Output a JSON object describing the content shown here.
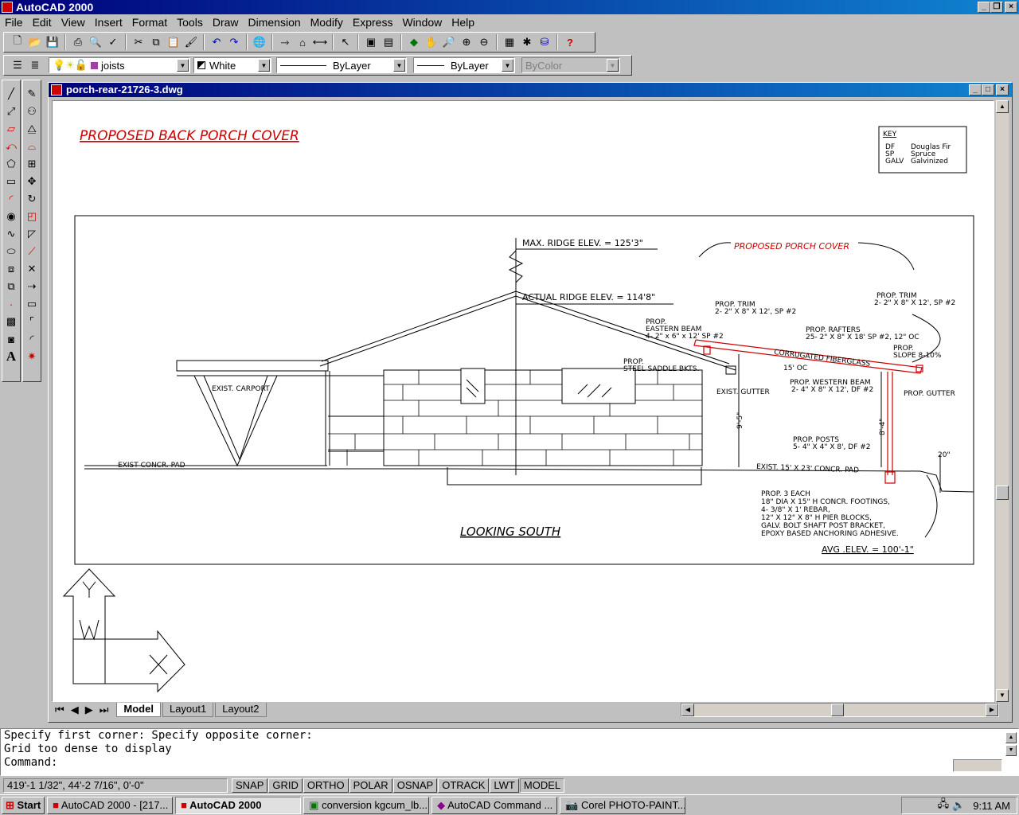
{
  "app": {
    "title": "AutoCAD 2000"
  },
  "menu": [
    "File",
    "Edit",
    "View",
    "Insert",
    "Format",
    "Tools",
    "Draw",
    "Dimension",
    "Modify",
    "Express",
    "Window",
    "Help"
  ],
  "layers": {
    "layer_name": "joists",
    "color": "White",
    "linetype": "ByLayer",
    "lineweight": "ByLayer",
    "plotstyle": "ByColor"
  },
  "document": {
    "title": "porch-rear-21726-3.dwg"
  },
  "drawing": {
    "title": "PROPOSED BACK PORCH COVER",
    "key": {
      "heading": "KEY",
      "entries": [
        {
          "abbr": "DF",
          "meaning": "Douglas Fir"
        },
        {
          "abbr": "SP",
          "meaning": "Spruce"
        },
        {
          "abbr": "GALV",
          "meaning": "Galvinized"
        }
      ]
    },
    "max_ridge": "MAX. RIDGE ELEV. = 125'3\"",
    "actual_ridge": "ACTUAL RIDGE ELEV. = 114'8\"",
    "proposed_porch": "PROPOSED PORCH COVER",
    "prop_trim_1_a": "PROP. TRIM",
    "prop_trim_1_b": "2- 2\" X 8\" X 12', SP #2",
    "prop_trim_2_a": "PROP. TRIM",
    "prop_trim_2_b": "2- 2\" X 8\" X 12', SP #2",
    "eastern_beam_a": "PROP.",
    "eastern_beam_b": "EASTERN BEAM",
    "eastern_beam_c": "4- 2\" x 6\" x 12' SP #2",
    "rafters_a": "PROP. RAFTERS",
    "rafters_b": "25- 2\" X 8\" X 18' SP #2, 12\" OC",
    "corrugated": "CORRUGATED FIBERGLASS",
    "slope_a": "PROP.",
    "slope_b": "SLOPE 8-10%",
    "saddle_a": "PROP.",
    "saddle_b": "STEEL SADDLE BKTS.",
    "oc_15": "15' OC",
    "western_beam_a": "PROP. WESTERN BEAM",
    "western_beam_b": "2- 4\" X 8\" X 12', DF #2",
    "exist_gutter": "EXIST. GUTTER",
    "prop_gutter": "PROP. GUTTER",
    "exist_carport": "EXIST. CARPORT",
    "exist_concr_pad": "EXIST CONCR. PAD",
    "dim_95": "9'-5\"",
    "dim_84": "8'-4\"",
    "posts_a": "PROP. POSTS",
    "posts_b": "5- 4\" X 4\" X 8', DF #2",
    "exist_15x23": "EXIST. 15' X 23' CONCR. PAD",
    "dim_20": "20\"",
    "footing_notes": [
      "PROP. 3 EACH",
      "18\" DIA X 15\" H CONCR. FOOTINGS,",
      "4- 3/8\" X 1' REBAR,",
      "12\" X 12\" X 8\" H PIER BLOCKS,",
      "GALV. BOLT SHAFT POST BRACKET,",
      "EPOXY BASED ANCHORING ADHESIVE."
    ],
    "looking_south": "LOOKING SOUTH",
    "avg_elev": "AVG .ELEV. = 100'-1\""
  },
  "ucs": {
    "y_label": "Y",
    "w_label": "W",
    "x_label": "X"
  },
  "tabs": [
    "Model",
    "Layout1",
    "Layout2"
  ],
  "command": {
    "line1": "Specify first corner: Specify opposite corner:",
    "line2": "Grid too dense to display",
    "prompt": "Command:"
  },
  "status": {
    "coords": "419'-1 1/32\", 44'-2 7/16\", 0'-0\"",
    "toggles": [
      "SNAP",
      "GRID",
      "ORTHO",
      "POLAR",
      "OSNAP",
      "OTRACK",
      "LWT",
      "MODEL"
    ]
  },
  "taskbar": {
    "start": "Start",
    "tasks": [
      "AutoCAD 2000 - [217...",
      "AutoCAD 2000",
      "conversion kgcum_lb...",
      "AutoCAD Command ...",
      "Corel PHOTO-PAINT..."
    ],
    "clock": "9:11 AM"
  },
  "colors": {
    "title_blue": "#00007b",
    "red": "#d00000",
    "face": "#c0c0c0"
  }
}
